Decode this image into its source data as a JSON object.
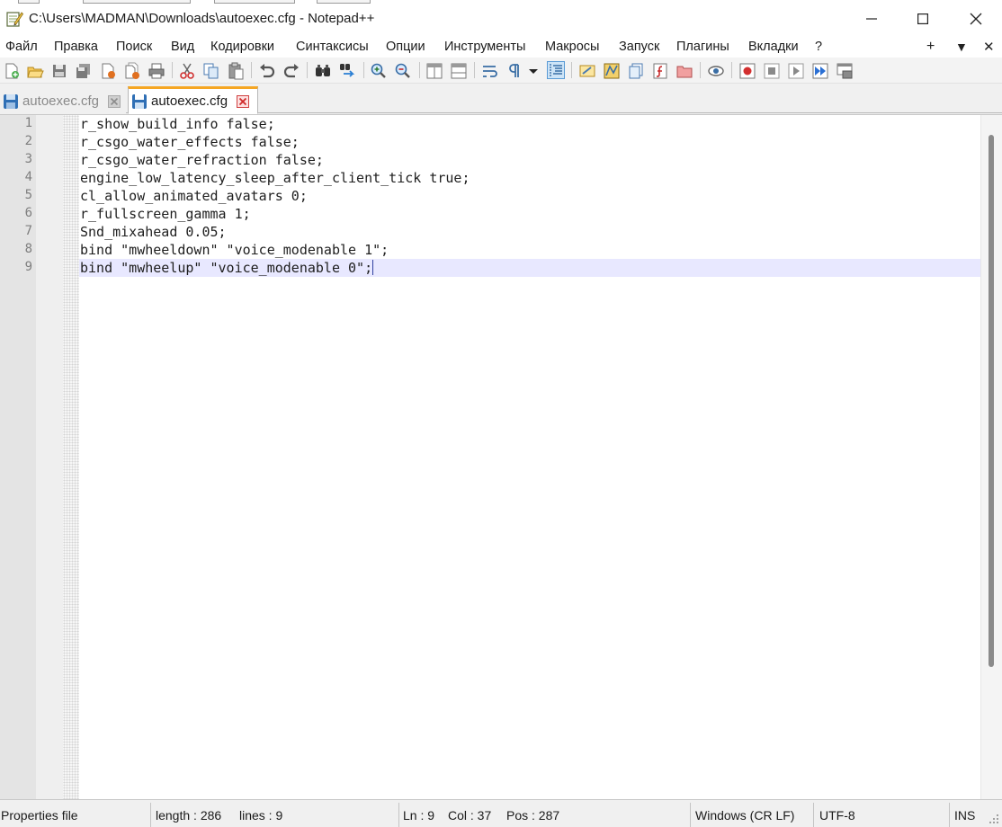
{
  "window": {
    "title": "C:\\Users\\MADMAN\\Downloads\\autoexec.cfg - Notepad++",
    "controls": [
      "minimize",
      "maximize",
      "close"
    ]
  },
  "menu": {
    "items": [
      "Файл",
      "Правка",
      "Поиск",
      "Вид",
      "Кодировки",
      "Синтаксисы",
      "Опции",
      "Инструменты",
      "Макросы",
      "Запуск",
      "Плагины",
      "Вкладки",
      "?"
    ],
    "right": [
      "+",
      "▼",
      "✕"
    ]
  },
  "toolbar": {
    "icons": [
      "new-file-icon",
      "open-file-icon",
      "save-icon",
      "save-all-icon",
      "close-file-icon",
      "close-all-icon",
      "print-icon",
      "cut-icon",
      "copy-icon",
      "paste-icon",
      "undo-icon",
      "redo-icon",
      "find-icon",
      "replace-icon",
      "zoom-in-icon",
      "zoom-out-icon",
      "sync-vertical-icon",
      "sync-horizontal-icon",
      "word-wrap-icon",
      "show-all-characters-icon",
      "dropdown-arrow-icon",
      "indent-guide-icon",
      "udl-icon",
      "document-map-icon",
      "document-list-icon",
      "function-list-icon",
      "folder-workspace-icon",
      "monitoring-icon",
      "record-macro-icon",
      "stop-macro-icon",
      "play-macro-icon",
      "run-macro-multiple-icon",
      "save-macro-icon"
    ],
    "active": "indent-guide-icon"
  },
  "tabs": [
    {
      "label": "autoexec.cfg",
      "active": false
    },
    {
      "label": "autoexec.cfg",
      "active": true
    }
  ],
  "editor": {
    "lines": [
      {
        "num": "1",
        "text": "r_show_build_info false;"
      },
      {
        "num": "2",
        "text": "r_csgo_water_effects false;"
      },
      {
        "num": "3",
        "text": "r_csgo_water_refraction false;"
      },
      {
        "num": "4",
        "text": "engine_low_latency_sleep_after_client_tick true;"
      },
      {
        "num": "5",
        "text": "cl_allow_animated_avatars 0;"
      },
      {
        "num": "6",
        "text": "r_fullscreen_gamma 1;"
      },
      {
        "num": "7",
        "text": "Snd_mixahead 0.05;"
      },
      {
        "num": "8",
        "text": "bind \"mwheeldown\" \"voice_modenable 1\";"
      },
      {
        "num": "9",
        "text": "bind \"mwheelup\" \"voice_modenable 0\";"
      }
    ],
    "current_line": 9
  },
  "status": {
    "file_type": "Properties file",
    "length": "length : 286",
    "lines": "lines : 9",
    "ln": "Ln : 9",
    "col": "Col : 37",
    "pos": "Pos : 287",
    "eol": "Windows (CR LF)",
    "encoding": "UTF-8",
    "mode": "INS"
  },
  "colors": {
    "accent_tab": "#f5a623",
    "current_line": "#e8e8ff",
    "gutter": "#e4e4e4"
  }
}
